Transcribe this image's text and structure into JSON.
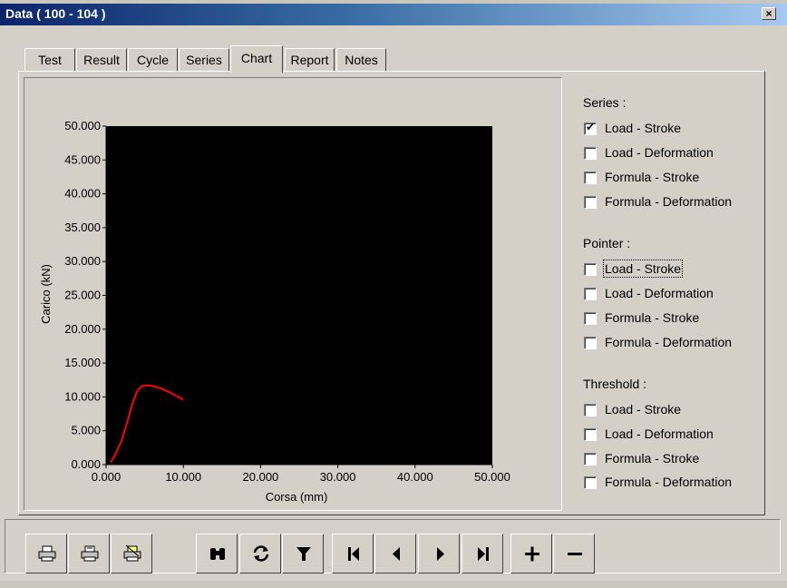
{
  "window": {
    "title": "Data ( 100 - 104 )",
    "close_label": "×"
  },
  "tabs": [
    {
      "label": "Test"
    },
    {
      "label": "Result"
    },
    {
      "label": "Cycle"
    },
    {
      "label": "Series"
    },
    {
      "label": "Chart",
      "active": true
    },
    {
      "label": "Report"
    },
    {
      "label": "Notes"
    }
  ],
  "chart_data": {
    "type": "line",
    "xlabel": "Corsa (mm)",
    "ylabel": "Carico (kN)",
    "xlim": [
      0,
      50
    ],
    "ylim": [
      0,
      50
    ],
    "x_ticks": [
      "0.000",
      "10.000",
      "20.000",
      "30.000",
      "40.000",
      "50.000"
    ],
    "y_ticks": [
      "0.000",
      "5.000",
      "10.000",
      "15.000",
      "20.000",
      "25.000",
      "30.000",
      "35.000",
      "40.000",
      "45.000",
      "50.000"
    ],
    "background": "#000000",
    "series": [
      {
        "color": "#ff0000",
        "x": [
          0.6,
          1.2,
          2.0,
          2.8,
          3.4,
          4.0,
          4.5,
          5.0,
          5.5,
          6.0,
          7.0,
          8.0,
          9.0,
          10.0
        ],
        "y": [
          0.3,
          1.5,
          3.5,
          6.5,
          9.0,
          10.8,
          11.5,
          11.7,
          11.7,
          11.6,
          11.3,
          10.8,
          10.2,
          9.6
        ]
      }
    ]
  },
  "series_group": {
    "title": "Series :",
    "items": [
      {
        "label": "Load - Stroke",
        "checked": true
      },
      {
        "label": "Load - Deformation",
        "checked": false
      },
      {
        "label": "Formula - Stroke",
        "checked": false
      },
      {
        "label": "Formula - Deformation",
        "checked": false
      }
    ]
  },
  "pointer_group": {
    "title": "Pointer :",
    "items": [
      {
        "label": "Load - Stroke",
        "checked": false
      },
      {
        "label": "Load - Deformation",
        "checked": false
      },
      {
        "label": "Formula - Stroke",
        "checked": false
      },
      {
        "label": "Formula - Deformation",
        "checked": false
      }
    ]
  },
  "threshold_group": {
    "title": "Threshold :",
    "items": [
      {
        "label": "Load - Stroke",
        "checked": false
      },
      {
        "label": "Load - Deformation",
        "checked": false
      },
      {
        "label": "Formula - Stroke",
        "checked": false
      },
      {
        "label": "Formula - Deformation",
        "checked": false
      }
    ]
  },
  "toolbar": {
    "buttons": [
      {
        "icon": "printer-icon"
      },
      {
        "icon": "print-preview-icon"
      },
      {
        "icon": "print-setup-icon"
      },
      {
        "icon": "binoculars-icon"
      },
      {
        "icon": "refresh-icon"
      },
      {
        "icon": "filter-icon"
      },
      {
        "icon": "first-record-icon"
      },
      {
        "icon": "previous-record-icon"
      },
      {
        "icon": "next-record-icon"
      },
      {
        "icon": "last-record-icon"
      },
      {
        "icon": "plus-icon"
      },
      {
        "icon": "minus-icon"
      }
    ]
  }
}
